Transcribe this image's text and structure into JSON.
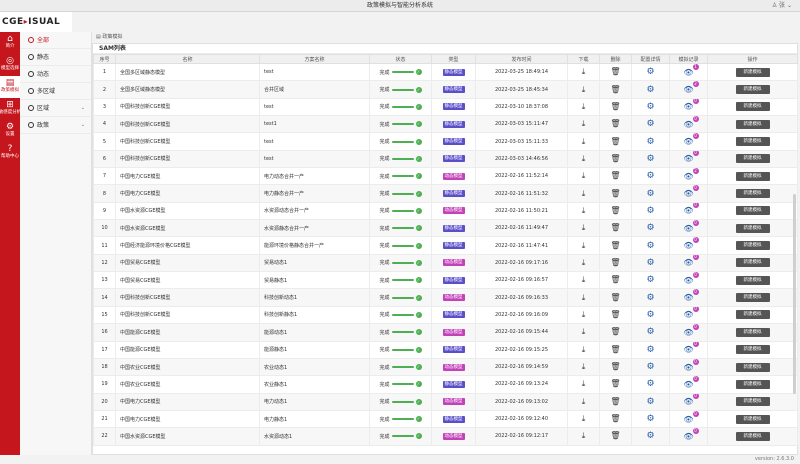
{
  "window": {
    "title": "政策模拟与智能分析系统",
    "user": "张"
  },
  "logo": {
    "text": "CGE",
    "text2": "ISUAL"
  },
  "rail": [
    {
      "label": "简介",
      "icon": "home-icon",
      "glyph": "⌂"
    },
    {
      "label": "模型选择",
      "icon": "target-icon",
      "glyph": "◎"
    },
    {
      "label": "政策模拟",
      "icon": "document-icon",
      "glyph": "▤",
      "active": true
    },
    {
      "label": "敏感度分析",
      "icon": "grid-icon",
      "glyph": "⊞"
    },
    {
      "label": "设置",
      "icon": "settings-icon",
      "glyph": "⚙"
    },
    {
      "label": "帮助中心",
      "icon": "help-icon",
      "glyph": "?"
    }
  ],
  "subnav": [
    {
      "label": "全部",
      "active": true
    },
    {
      "label": "静态"
    },
    {
      "label": "动态"
    },
    {
      "label": "多区域"
    },
    {
      "label": "区域",
      "chevron": true
    },
    {
      "label": "政策",
      "chevron": true
    }
  ],
  "breadcrumb": "政策模拟",
  "panel": {
    "title": "SAM列表"
  },
  "columns": [
    "序号",
    "名称",
    "方案名称",
    "状态",
    "类型",
    "发布时间",
    "下载",
    "删除",
    "配置详情",
    "模拟记录",
    "操作"
  ],
  "labels": {
    "status": "完成",
    "static": "静态模型",
    "dynamic": "动态模型",
    "new_sim": "新建模拟"
  },
  "rows": [
    {
      "no": "1",
      "name": "全国多区域静态模型",
      "scheme": "test",
      "type": "static",
      "time": "2022-03-25 18:49:14",
      "badge": "1"
    },
    {
      "no": "2",
      "name": "全国多区域静态模型",
      "scheme": "合并区域",
      "type": "static",
      "time": "2022-03-25 18:45:34",
      "badge": "2"
    },
    {
      "no": "3",
      "name": "中国科技创新CGE模型",
      "scheme": "test",
      "type": "static",
      "time": "2022-03-10 18:37:08",
      "badge": "0"
    },
    {
      "no": "4",
      "name": "中国科技创新CGE模型",
      "scheme": "test1",
      "type": "static",
      "time": "2022-03-03 15:11:47",
      "badge": "0"
    },
    {
      "no": "5",
      "name": "中国科技创新CGE模型",
      "scheme": "test",
      "type": "static",
      "time": "2022-03-03 15:11:33",
      "badge": "0"
    },
    {
      "no": "6",
      "name": "中国科技创新CGE模型",
      "scheme": "test",
      "type": "static",
      "time": "2022-03-03 14:46:56",
      "badge": "0"
    },
    {
      "no": "7",
      "name": "中国电力CGE模型",
      "scheme": "电力动态合并一产",
      "type": "dynamic",
      "time": "2022-02-16 11:52:14",
      "badge": "2"
    },
    {
      "no": "8",
      "name": "中国电力CGE模型",
      "scheme": "电力静态合并一产",
      "type": "static",
      "time": "2022-02-16 11:51:32",
      "badge": "0"
    },
    {
      "no": "9",
      "name": "中国水资源CGE模型",
      "scheme": "水资源动态合并一产",
      "type": "dynamic",
      "time": "2022-02-16 11:50:21",
      "badge": "0"
    },
    {
      "no": "10",
      "name": "中国水资源CGE模型",
      "scheme": "水资源静态合并一产",
      "type": "static",
      "time": "2022-02-16 11:49:47",
      "badge": "0"
    },
    {
      "no": "11",
      "name": "中国经济能源环境价格CGE模型",
      "scheme": "能源环境价格静态合并一产",
      "type": "static",
      "time": "2022-02-16 11:47:41",
      "badge": "0"
    },
    {
      "no": "12",
      "name": "中国贸易CGE模型",
      "scheme": "贸易动态1",
      "type": "dynamic",
      "time": "2022-02-16 09:17:16",
      "badge": "0"
    },
    {
      "no": "13",
      "name": "中国贸易CGE模型",
      "scheme": "贸易静态1",
      "type": "static",
      "time": "2022-02-16 09:16:57",
      "badge": "0"
    },
    {
      "no": "14",
      "name": "中国科技创新CGE模型",
      "scheme": "科技创新动态1",
      "type": "dynamic",
      "time": "2022-02-16 09:16:33",
      "badge": "0"
    },
    {
      "no": "15",
      "name": "中国科技创新CGE模型",
      "scheme": "科技创新静态1",
      "type": "static",
      "time": "2022-02-16 09:16:09",
      "badge": "0"
    },
    {
      "no": "16",
      "name": "中国能源CGE模型",
      "scheme": "能源动态1",
      "type": "dynamic",
      "time": "2022-02-16 09:15:44",
      "badge": "0"
    },
    {
      "no": "17",
      "name": "中国能源CGE模型",
      "scheme": "能源静态1",
      "type": "static",
      "time": "2022-02-16 09:15:25",
      "badge": "0"
    },
    {
      "no": "18",
      "name": "中国农业CGE模型",
      "scheme": "农业动态1",
      "type": "dynamic",
      "time": "2022-02-16 09:14:59",
      "badge": "0"
    },
    {
      "no": "19",
      "name": "中国农业CGE模型",
      "scheme": "农业静态1",
      "type": "static",
      "time": "2022-02-16 09:13:24",
      "badge": "0"
    },
    {
      "no": "20",
      "name": "中国电力CGE模型",
      "scheme": "电力动态1",
      "type": "dynamic",
      "time": "2022-02-16 09:13:02",
      "badge": "0"
    },
    {
      "no": "21",
      "name": "中国电力CGE模型",
      "scheme": "电力静态1",
      "type": "static",
      "time": "2022-02-16 09:12:40",
      "badge": "0"
    },
    {
      "no": "22",
      "name": "中国水资源CGE模型",
      "scheme": "水资源动态1",
      "type": "dynamic",
      "time": "2022-02-16 09:12:17",
      "badge": "0"
    }
  ],
  "footer": {
    "version": "version: 2.6.3.0"
  },
  "colors": {
    "brand": "#c4161c",
    "static_tag": "#5b4fc8",
    "dynamic_tag": "#c243b8",
    "success": "#4caf50",
    "icon_blue": "#1e5aa8"
  }
}
